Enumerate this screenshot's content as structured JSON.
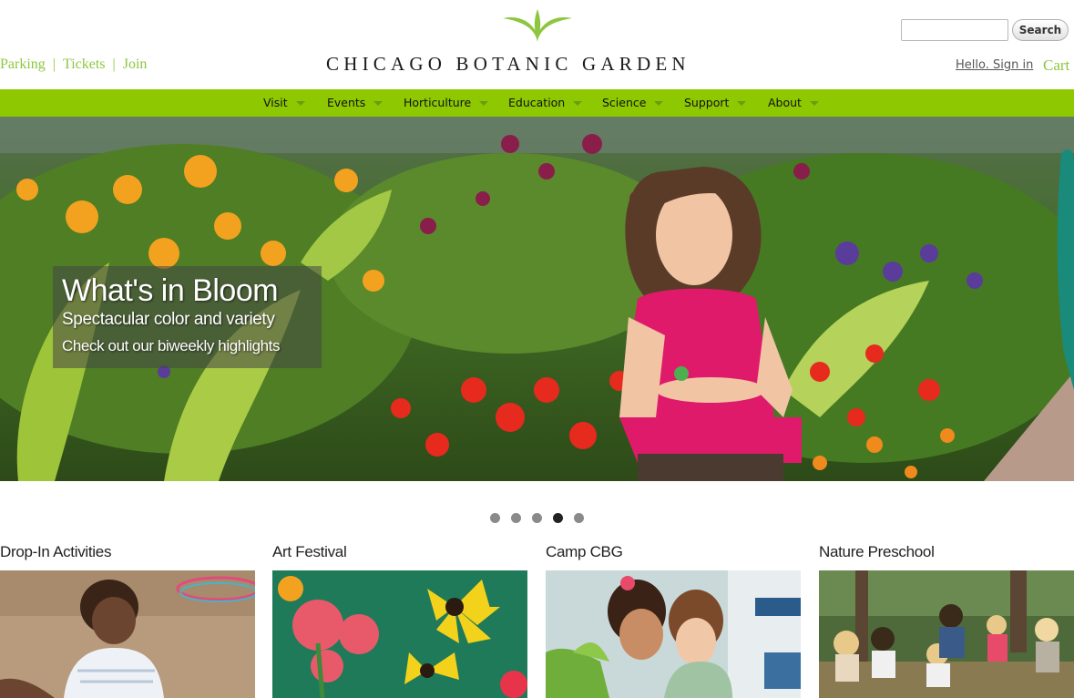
{
  "header": {
    "util_links": [
      {
        "label": "Parking"
      },
      {
        "label": "Tickets"
      },
      {
        "label": "Join"
      }
    ],
    "separator": "|",
    "logo_text": "CHICAGO BOTANIC GARDEN",
    "search": {
      "placeholder": "",
      "button_label": "Search"
    },
    "signin_label": "Hello. Sign in",
    "cart_label": "Cart"
  },
  "nav": {
    "items": [
      {
        "label": "Visit"
      },
      {
        "label": "Events"
      },
      {
        "label": "Horticulture"
      },
      {
        "label": "Education"
      },
      {
        "label": "Science"
      },
      {
        "label": "Support"
      },
      {
        "label": "About"
      }
    ]
  },
  "hero": {
    "title": "What's in Bloom",
    "subtitle": "Spectacular color and variety",
    "link_text": "Check out our biweekly highlights"
  },
  "slider": {
    "slide_count": 5,
    "active_index": 3
  },
  "features": [
    {
      "title": "Drop-In Activities"
    },
    {
      "title": "Art Festival"
    },
    {
      "title": "Camp CBG"
    },
    {
      "title": "Nature Preschool"
    }
  ],
  "colors": {
    "brand_green": "#8dc63f",
    "nav_green": "#8dc800",
    "text_dark": "#222222"
  },
  "icons": [
    "leaf-logo-icon",
    "chevron-down-icon"
  ]
}
